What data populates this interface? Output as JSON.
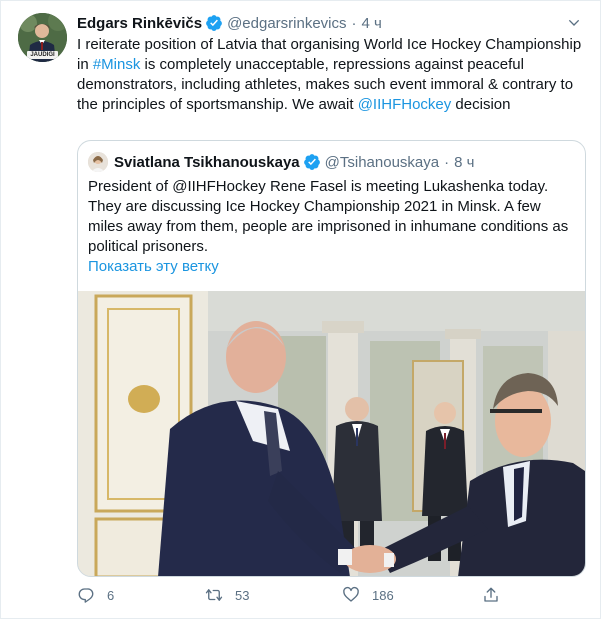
{
  "author": {
    "name": "Edgars Rinkēvičs",
    "handle": "@edgarsrinkevics",
    "time": "4 ч",
    "avatar_badge": "JAUDIGI"
  },
  "tweet": {
    "text_1": "I reiterate position of Latvia that organising World Ice Hockey Championship in ",
    "hashtag": "#Minsk",
    "text_2": " is completely unacceptable, repressions against peaceful demonstrators, including athletes, makes such event immoral & contrary to the principles of sportsmanship. We await ",
    "mention": "@IIHFHockey",
    "text_3": " decision"
  },
  "quoted": {
    "name": "Sviatlana Tsikhanouskaya",
    "handle": "@Tsihanouskaya",
    "time": "8 ч",
    "text": "President of @IIHFHockey Rene Fasel is meeting Lukashenka today. They are discussing Ice Hockey Championship 2021 in Minsk. A few miles away from them, people are imprisoned in inhumane conditions as political prisoners.",
    "show_thread": "Показать эту ветку"
  },
  "actions": {
    "replies": "6",
    "retweets": "53",
    "likes": "186"
  },
  "icons": {
    "verified": "verified-badge-icon",
    "caret": "chevron-down-icon",
    "reply": "reply-icon",
    "retweet": "retweet-icon",
    "like": "heart-icon",
    "share": "share-icon"
  },
  "colors": {
    "link": "#1b95e0",
    "verified": "#1da1f2",
    "muted": "#5b7083",
    "border": "#cfd9de"
  }
}
